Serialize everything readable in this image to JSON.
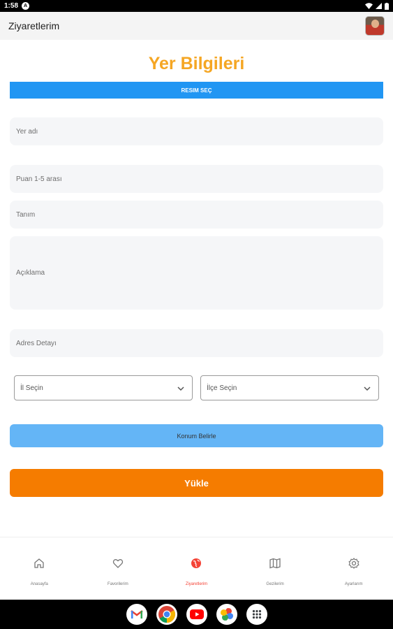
{
  "status": {
    "time": "1:58",
    "a_icon": "A"
  },
  "app_bar": {
    "title": "Ziyaretlerim"
  },
  "page_title": "Yer Bilgileri",
  "pick_image_label": "RESIM SEÇ",
  "fields": {
    "place_name": "Yer adı",
    "rating": "Puan 1-5 arası",
    "definition": "Tanım",
    "description": "Açıklama",
    "address": "Adres Detayı"
  },
  "selects": {
    "city": "İl Seçin",
    "district": "İlçe Seçin"
  },
  "locate_label": "Konum Belirle",
  "upload_label": "Yükle",
  "nav": [
    {
      "label": "Anasayfa",
      "icon": "home-icon"
    },
    {
      "label": "Favorilerim",
      "icon": "heart-icon"
    },
    {
      "label": "Ziyaretlerim",
      "icon": "globe-icon"
    },
    {
      "label": "Gezilerim",
      "icon": "map-icon"
    },
    {
      "label": "Ayarlarım",
      "icon": "gear-icon"
    }
  ],
  "colors": {
    "accent_title": "#f5a623",
    "primary": "#2196f3",
    "upload": "#f57c00",
    "active_nav": "#f44336"
  }
}
